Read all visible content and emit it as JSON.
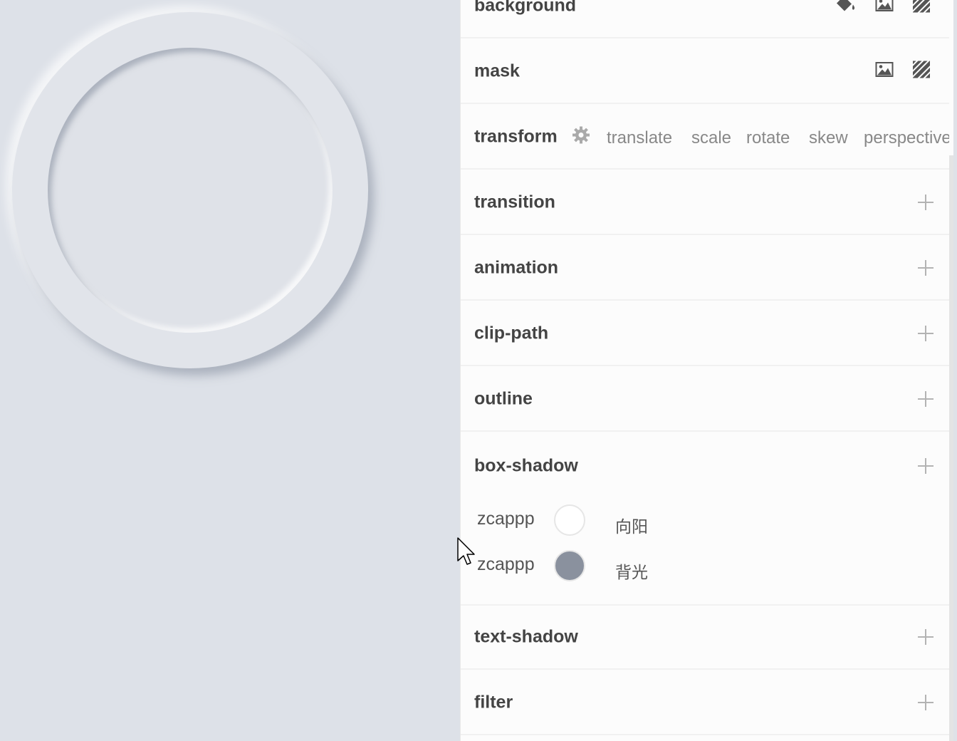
{
  "canvas": {
    "outer_color": "#e1e4ea",
    "inner_color": "#dfe2e8"
  },
  "panel": {
    "background": {
      "title": "background",
      "icons": [
        "paint-bucket-icon",
        "image-icon",
        "hatch-pattern-icon"
      ]
    },
    "mask": {
      "title": "mask",
      "icons": [
        "image-icon",
        "hatch-pattern-icon"
      ]
    },
    "transform": {
      "title": "transform",
      "options": [
        "translate",
        "scale",
        "rotate",
        "skew",
        "perspective"
      ]
    },
    "transition": {
      "title": "transition"
    },
    "animation": {
      "title": "animation"
    },
    "clip_path": {
      "title": "clip-path"
    },
    "outline": {
      "title": "outline"
    },
    "box_shadow": {
      "title": "box-shadow",
      "shadows": [
        {
          "name": "zcappp",
          "color": "#ffffff",
          "label": "向阳"
        },
        {
          "name": "zcappp",
          "color": "#8a919e",
          "label": "背光"
        }
      ]
    },
    "text_shadow": {
      "title": "text-shadow"
    },
    "filter": {
      "title": "filter"
    }
  }
}
